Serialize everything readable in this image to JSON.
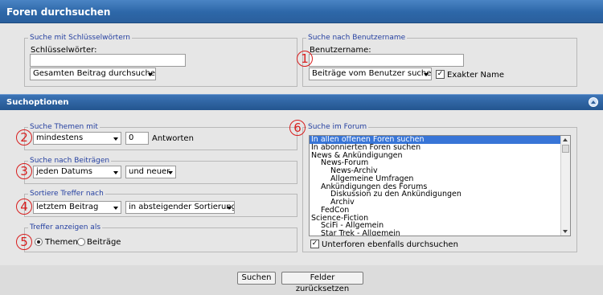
{
  "title": "Foren durchsuchen",
  "keywords": {
    "legend": "Suche mit Schlüsselwörtern",
    "label": "Schlüsselwörter:",
    "value": "",
    "scope": "Gesamten Beitrag durchsuchen"
  },
  "username": {
    "legend": "Suche nach Benutzername",
    "label": "Benutzername:",
    "value": "",
    "mode": "Beiträge vom Benutzer suchen",
    "exact_checked": true,
    "exact_label": "Exakter Name"
  },
  "options_bar": {
    "title": "Suchoptionen"
  },
  "topics": {
    "legend": "Suche Themen mit",
    "condition": "mindestens",
    "count": "0",
    "suffix": "Antworten"
  },
  "posts": {
    "legend": "Suche nach Beiträgen",
    "date": "jeden Datums",
    "direction": "und neuer"
  },
  "sort": {
    "legend": "Sortiere Treffer nach",
    "field": "letztem Beitrag",
    "order": "in absteigender Sortierung"
  },
  "display": {
    "legend": "Treffer anzeigen als",
    "options": [
      "Themen",
      "Beiträge"
    ],
    "selected": 0
  },
  "forum": {
    "legend": "Suche im Forum",
    "items": [
      "In allen offenen Foren suchen",
      "In abonnierten Foren suchen",
      "News & Ankündigungen",
      "News-Forum",
      "News-Archiv",
      "Allgemeine Umfragen",
      "Ankündigungen des Forums",
      "Diskussion zu den Ankündigungen",
      "Archiv",
      "FedCon",
      "Science-Fiction",
      "SciFi - Allgemein",
      "Star Trek - Allgemein"
    ],
    "selected": 0,
    "subforums_checked": true,
    "subforums_label": "Unterforen ebenfalls durchsuchen"
  },
  "badges": [
    "1",
    "2",
    "3",
    "4",
    "5",
    "6"
  ],
  "buttons": {
    "search": "Suchen",
    "reset": "Felder zurücksetzen"
  },
  "colors": {
    "header": "#2d67a8",
    "legend": "#243fa0",
    "badge": "#d81e1e",
    "selection": "#3875d7"
  }
}
